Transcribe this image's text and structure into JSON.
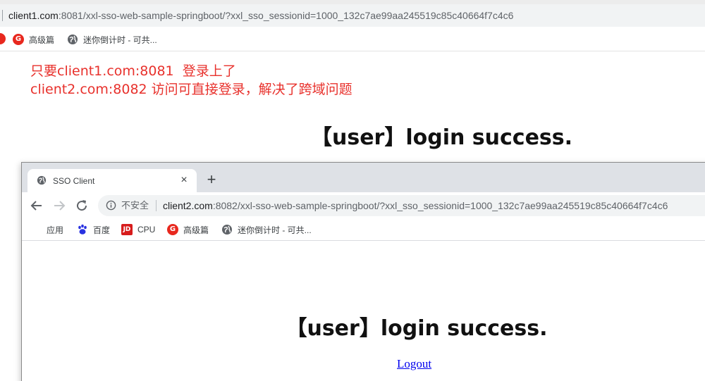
{
  "window1": {
    "url_host": "client1.com",
    "url_rest": ":8081/xxl-sso-web-sample-springboot/?xxl_sso_sessionid=1000_132c7ae99aa245519c85c40664f7c4c6",
    "bookmarks": [
      {
        "label": "高级篇",
        "icon": "g-logo-icon"
      },
      {
        "label": "迷你倒计时 - 可共...",
        "icon": "globe-icon"
      }
    ],
    "heading": "【user】login success."
  },
  "annotation": {
    "line1": "只要client1.com:8081  登录上了",
    "line2": "client2.com:8082 访问可直接登录，解决了跨域问题",
    "color": "#e8312c"
  },
  "window2": {
    "tab": {
      "title": "SSO Client",
      "close": "×"
    },
    "new_tab": "+",
    "security_label": "不安全",
    "url_host": "client2.com",
    "url_rest": ":8082/xxl-sso-web-sample-springboot/?xxl_sso_sessionid=1000_132c7ae99aa245519c85c40664f7c4c6",
    "bookmarks": [
      {
        "label": "应用",
        "icon": "apps-grid-icon"
      },
      {
        "label": "百度",
        "icon": "baidu-paw-icon"
      },
      {
        "label": "CPU",
        "icon": "jd-logo-icon"
      },
      {
        "label": "高级篇",
        "icon": "g-logo-icon"
      },
      {
        "label": "迷你倒计时 - 可共...",
        "icon": "globe-icon"
      }
    ],
    "heading": "【user】login success.",
    "logout_link": "Logout"
  },
  "icons": {
    "jd_text": "JD",
    "g_text": "G"
  }
}
